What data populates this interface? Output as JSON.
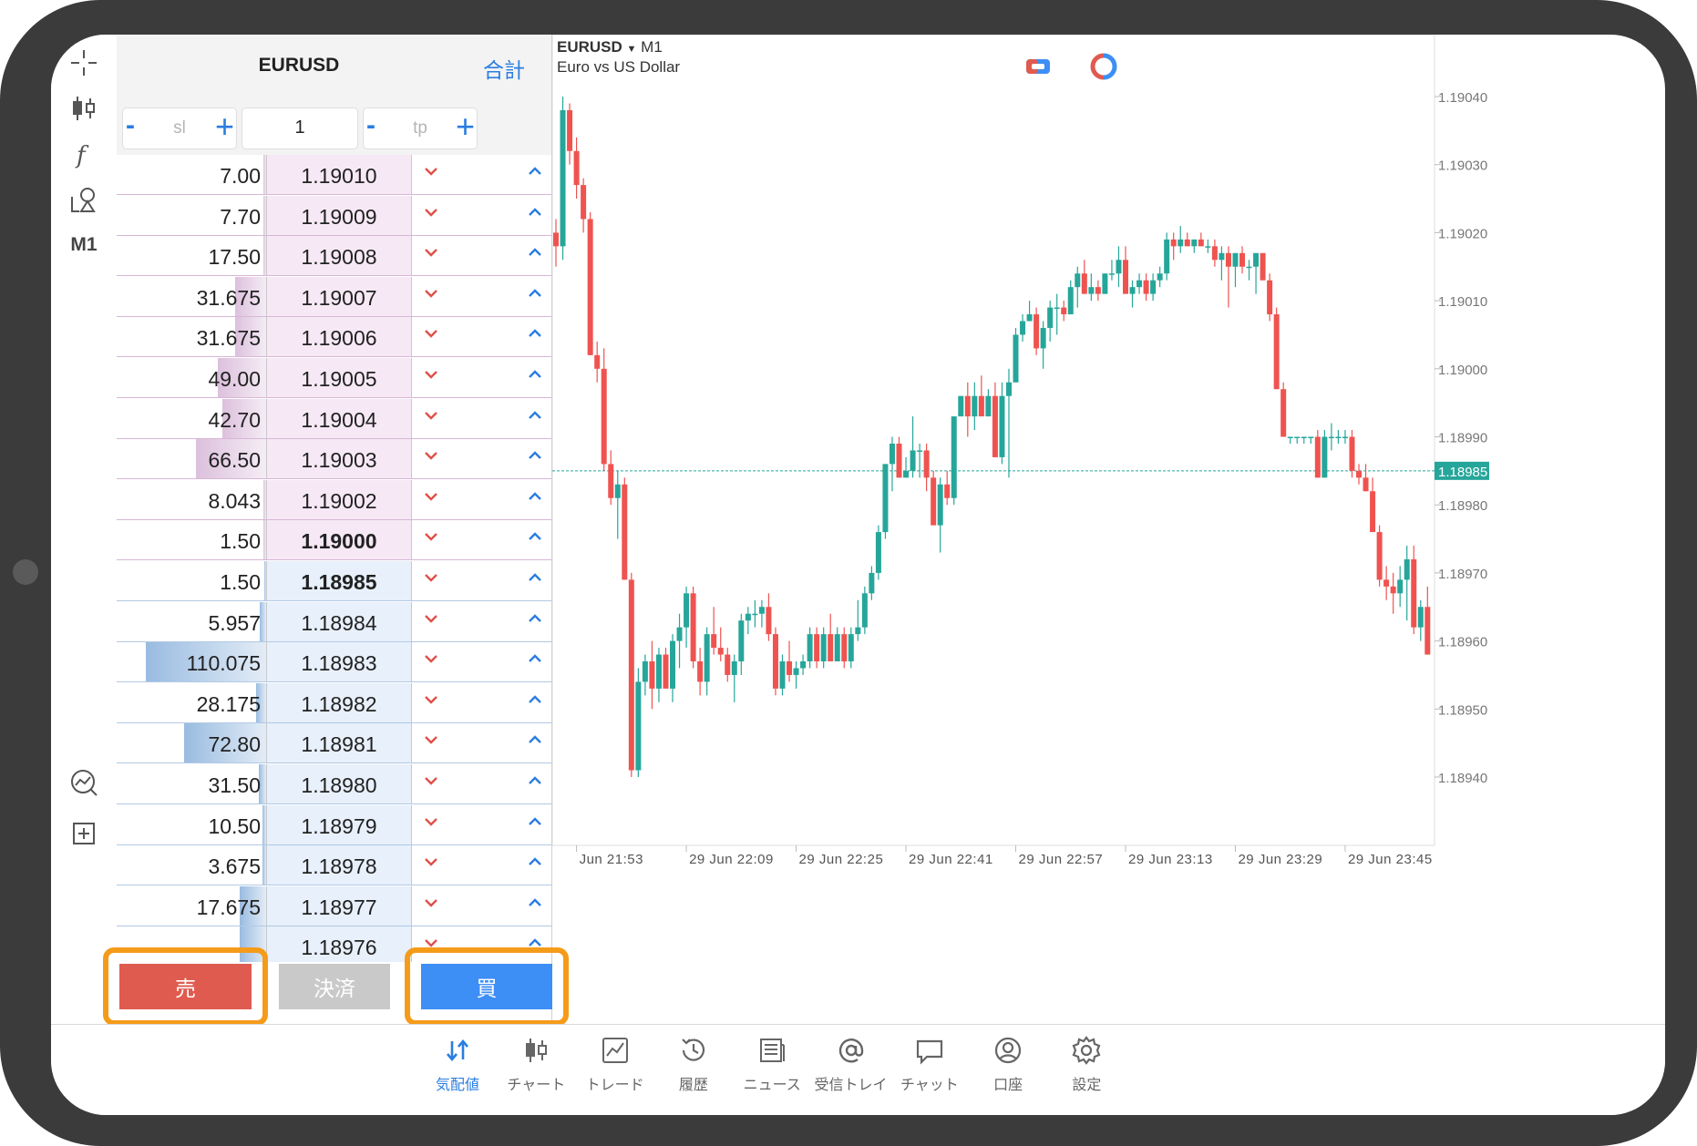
{
  "dom": {
    "symbol": "EURUSD",
    "total_label": "合計",
    "sl": {
      "placeholder": "sl"
    },
    "volume": "1",
    "tp": {
      "placeholder": "tp"
    },
    "sell_rows": [
      {
        "volume": "7.00",
        "price": "1.19010",
        "bar": 0.02
      },
      {
        "volume": "7.70",
        "price": "1.19009",
        "bar": 0.02
      },
      {
        "volume": "17.50",
        "price": "1.19008",
        "bar": 0.02
      },
      {
        "volume": "31.675",
        "price": "1.19007",
        "bar": 0.26
      },
      {
        "volume": "31.675",
        "price": "1.19006",
        "bar": 0.26
      },
      {
        "volume": "49.00",
        "price": "1.19005",
        "bar": 0.4
      },
      {
        "volume": "42.70",
        "price": "1.19004",
        "bar": 0.36
      },
      {
        "volume": "66.50",
        "price": "1.19003",
        "bar": 0.58
      },
      {
        "volume": "8.043",
        "price": "1.19002",
        "bar": 0.02
      },
      {
        "volume": "1.50",
        "price": "1.19000",
        "bar": 0.02,
        "bold": true
      }
    ],
    "buy_rows": [
      {
        "volume": "1.50",
        "price": "1.18985",
        "bar": 0.01,
        "bold": true
      },
      {
        "volume": "5.957",
        "price": "1.18984",
        "bar": 0.05
      },
      {
        "volume": "110.075",
        "price": "1.18983",
        "bar": 1.0
      },
      {
        "volume": "28.175",
        "price": "1.18982",
        "bar": 0.08
      },
      {
        "volume": "72.80",
        "price": "1.18981",
        "bar": 0.68
      },
      {
        "volume": "31.50",
        "price": "1.18980",
        "bar": 0.06
      },
      {
        "volume": "10.50",
        "price": "1.18979",
        "bar": 0.03
      },
      {
        "volume": "3.675",
        "price": "1.18978",
        "bar": 0.03
      },
      {
        "volume": "17.675",
        "price": "1.18977",
        "bar": 0.22
      },
      {
        "volume": "",
        "price": "1.18976",
        "bar": 0.22
      }
    ]
  },
  "buttons": {
    "sell": "売",
    "close": "決済",
    "buy": "買"
  },
  "toolbar": {
    "timeframe": "M1"
  },
  "chart": {
    "symbol": "EURUSD",
    "timeframe": "M1",
    "description": "Euro vs US Dollar",
    "current_price": "1.18985",
    "colors": {
      "bull": "#26a69a",
      "bear": "#ef5350",
      "price_line": "#26a69a",
      "highlight": "#f59b1a"
    }
  },
  "chart_data": {
    "type": "candlestick",
    "ylim": [
      1.18935,
      1.19045
    ],
    "yticks": [
      "1.19040",
      "1.19030",
      "1.19020",
      "1.19010",
      "1.19000",
      "1.18990",
      "1.18980",
      "1.18970",
      "1.18960",
      "1.18950",
      "1.18940"
    ],
    "xticks": [
      "Jun 21:53",
      "29 Jun 22:09",
      "29 Jun 22:25",
      "29 Jun 22:41",
      "29 Jun 22:57",
      "29 Jun 23:13",
      "29 Jun 23:29",
      "29 Jun 23:45"
    ],
    "xtick_index": [
      3,
      19,
      35,
      51,
      67,
      83,
      99,
      115
    ],
    "current_price": 1.18985,
    "candles": [
      [
        1.1902,
        1.19022,
        1.19015,
        1.19018
      ],
      [
        1.19018,
        1.1904,
        1.19016,
        1.19038
      ],
      [
        1.19038,
        1.19039,
        1.1903,
        1.19032
      ],
      [
        1.19032,
        1.19034,
        1.19025,
        1.19027
      ],
      [
        1.19027,
        1.19028,
        1.1902,
        1.19022
      ],
      [
        1.19022,
        1.19023,
        1.19002,
        1.19002
      ],
      [
        1.19002,
        1.19004,
        1.18998,
        1.19
      ],
      [
        1.19,
        1.19003,
        1.18985,
        1.18986
      ],
      [
        1.18986,
        1.18988,
        1.1898,
        1.18981
      ],
      [
        1.18981,
        1.18985,
        1.18975,
        1.18983
      ],
      [
        1.18983,
        1.18984,
        1.18969,
        1.18969
      ],
      [
        1.18969,
        1.1897,
        1.1894,
        1.18941
      ],
      [
        1.18941,
        1.18956,
        1.1894,
        1.18954
      ],
      [
        1.18954,
        1.18958,
        1.18952,
        1.18957
      ],
      [
        1.18957,
        1.1896,
        1.1895,
        1.18953
      ],
      [
        1.18953,
        1.18959,
        1.18951,
        1.18958
      ],
      [
        1.18958,
        1.18959,
        1.18953,
        1.18953
      ],
      [
        1.18953,
        1.18961,
        1.18951,
        1.1896
      ],
      [
        1.1896,
        1.18964,
        1.18956,
        1.18962
      ],
      [
        1.18962,
        1.18968,
        1.18959,
        1.18967
      ],
      [
        1.18967,
        1.18968,
        1.18956,
        1.18957
      ],
      [
        1.18957,
        1.18959,
        1.18952,
        1.18954
      ],
      [
        1.18954,
        1.18962,
        1.18952,
        1.18961
      ],
      [
        1.18961,
        1.18965,
        1.18958,
        1.18959
      ],
      [
        1.18959,
        1.18962,
        1.18957,
        1.18958
      ],
      [
        1.18958,
        1.18959,
        1.18954,
        1.18955
      ],
      [
        1.18955,
        1.18958,
        1.18951,
        1.18957
      ],
      [
        1.18957,
        1.18964,
        1.18955,
        1.18963
      ],
      [
        1.18963,
        1.18965,
        1.18961,
        1.18964
      ],
      [
        1.18964,
        1.18966,
        1.18962,
        1.18964
      ],
      [
        1.18964,
        1.18966,
        1.18962,
        1.18965
      ],
      [
        1.18965,
        1.18967,
        1.1896,
        1.18961
      ],
      [
        1.18961,
        1.18962,
        1.18952,
        1.18953
      ],
      [
        1.18953,
        1.18958,
        1.18952,
        1.18957
      ],
      [
        1.18957,
        1.1896,
        1.18954,
        1.18955
      ],
      [
        1.18955,
        1.18957,
        1.18953,
        1.18956
      ],
      [
        1.18956,
        1.18958,
        1.18955,
        1.18957
      ],
      [
        1.18957,
        1.18962,
        1.18956,
        1.18961
      ],
      [
        1.18961,
        1.18962,
        1.18956,
        1.18957
      ],
      [
        1.18957,
        1.18962,
        1.18956,
        1.18961
      ],
      [
        1.18961,
        1.18964,
        1.18957,
        1.18957
      ],
      [
        1.18957,
        1.18962,
        1.18957,
        1.18961
      ],
      [
        1.18961,
        1.18962,
        1.18956,
        1.18957
      ],
      [
        1.18957,
        1.18962,
        1.18956,
        1.18961
      ],
      [
        1.18961,
        1.18966,
        1.1896,
        1.18962
      ],
      [
        1.18962,
        1.18968,
        1.18961,
        1.18967
      ],
      [
        1.18967,
        1.18971,
        1.18966,
        1.1897
      ],
      [
        1.1897,
        1.18977,
        1.18969,
        1.18976
      ],
      [
        1.18976,
        1.18986,
        1.18975,
        1.18986
      ],
      [
        1.18986,
        1.1899,
        1.18982,
        1.18989
      ],
      [
        1.18989,
        1.1899,
        1.18984,
        1.18984
      ],
      [
        1.18984,
        1.18987,
        1.18984,
        1.18985
      ],
      [
        1.18985,
        1.18993,
        1.18984,
        1.18988
      ],
      [
        1.18988,
        1.18989,
        1.18984,
        1.18988
      ],
      [
        1.18988,
        1.18989,
        1.18982,
        1.18984
      ],
      [
        1.18984,
        1.18985,
        1.18977,
        1.18977
      ],
      [
        1.18977,
        1.18984,
        1.18973,
        1.18983
      ],
      [
        1.18983,
        1.18985,
        1.1898,
        1.18981
      ],
      [
        1.18981,
        1.18993,
        1.1898,
        1.18993
      ],
      [
        1.18993,
        1.18996,
        1.18993,
        1.18996
      ],
      [
        1.18996,
        1.18998,
        1.1899,
        1.18993
      ],
      [
        1.18993,
        1.18998,
        1.18991,
        1.18996
      ],
      [
        1.18996,
        1.18999,
        1.18993,
        1.18993
      ],
      [
        1.18993,
        1.18997,
        1.18993,
        1.18996
      ],
      [
        1.18996,
        1.18998,
        1.18987,
        1.18987
      ],
      [
        1.18987,
        1.18998,
        1.18986,
        1.18996
      ],
      [
        1.18996,
        1.19,
        1.18984,
        1.18998
      ],
      [
        1.18998,
        1.19006,
        1.18998,
        1.19005
      ],
      [
        1.19005,
        1.19008,
        1.19004,
        1.19007
      ],
      [
        1.19007,
        1.1901,
        1.19007,
        1.19008
      ],
      [
        1.19008,
        1.19009,
        1.19002,
        1.19003
      ],
      [
        1.19003,
        1.19007,
        1.19,
        1.19006
      ],
      [
        1.19006,
        1.1901,
        1.19004,
        1.19009
      ],
      [
        1.19009,
        1.19011,
        1.19005,
        1.19009
      ],
      [
        1.19009,
        1.1901,
        1.19007,
        1.19008
      ],
      [
        1.19008,
        1.19013,
        1.19008,
        1.19012
      ],
      [
        1.19012,
        1.19015,
        1.19009,
        1.19014
      ],
      [
        1.19014,
        1.19016,
        1.19011,
        1.19011
      ],
      [
        1.19011,
        1.19014,
        1.1901,
        1.19012
      ],
      [
        1.19012,
        1.19013,
        1.1901,
        1.19011
      ],
      [
        1.19011,
        1.19014,
        1.19011,
        1.19014
      ],
      [
        1.19014,
        1.19016,
        1.19013,
        1.19014
      ],
      [
        1.19014,
        1.19018,
        1.19012,
        1.19016
      ],
      [
        1.19016,
        1.19018,
        1.19011,
        1.19011
      ],
      [
        1.19011,
        1.19013,
        1.19009,
        1.19012
      ],
      [
        1.19012,
        1.19014,
        1.19011,
        1.19013
      ],
      [
        1.19013,
        1.19014,
        1.1901,
        1.19011
      ],
      [
        1.19011,
        1.19014,
        1.1901,
        1.19013
      ],
      [
        1.19013,
        1.19015,
        1.19012,
        1.19014
      ],
      [
        1.19014,
        1.1902,
        1.19013,
        1.19019
      ],
      [
        1.19019,
        1.1902,
        1.19016,
        1.19018
      ],
      [
        1.19018,
        1.19021,
        1.19017,
        1.19019
      ],
      [
        1.19019,
        1.1902,
        1.19018,
        1.19018
      ],
      [
        1.19018,
        1.19019,
        1.19017,
        1.19019
      ],
      [
        1.19019,
        1.1902,
        1.19018,
        1.19018
      ],
      [
        1.19018,
        1.19019,
        1.19017,
        1.19018
      ],
      [
        1.19018,
        1.19019,
        1.19015,
        1.19016
      ],
      [
        1.19016,
        1.19018,
        1.19013,
        1.19017
      ],
      [
        1.19017,
        1.19018,
        1.19009,
        1.19015
      ],
      [
        1.19015,
        1.19017,
        1.19012,
        1.19017
      ],
      [
        1.19017,
        1.19018,
        1.19014,
        1.19015
      ],
      [
        1.19015,
        1.19016,
        1.19013,
        1.19015
      ],
      [
        1.19015,
        1.19017,
        1.19011,
        1.19017
      ],
      [
        1.19017,
        1.19017,
        1.19013,
        1.19013
      ],
      [
        1.19013,
        1.19014,
        1.19007,
        1.19008
      ],
      [
        1.19008,
        1.19009,
        1.18997,
        1.18997
      ],
      [
        1.18997,
        1.18998,
        1.1899,
        1.1899
      ],
      [
        1.1899,
        1.1899,
        1.18989,
        1.1899
      ],
      [
        1.1899,
        1.1899,
        1.18989,
        1.1899
      ],
      [
        1.1899,
        1.1899,
        1.18989,
        1.1899
      ],
      [
        1.1899,
        1.1899,
        1.18989,
        1.1899
      ],
      [
        1.1899,
        1.18991,
        1.18984,
        1.18984
      ],
      [
        1.18984,
        1.18991,
        1.18984,
        1.1899
      ],
      [
        1.1899,
        1.18992,
        1.18988,
        1.1899
      ],
      [
        1.1899,
        1.18991,
        1.18989,
        1.1899
      ],
      [
        1.1899,
        1.18991,
        1.18989,
        1.1899
      ],
      [
        1.1899,
        1.18991,
        1.18984,
        1.18985
      ],
      [
        1.18985,
        1.18986,
        1.18983,
        1.18984
      ],
      [
        1.18984,
        1.18986,
        1.18982,
        1.18982
      ],
      [
        1.18982,
        1.18984,
        1.18976,
        1.18976
      ],
      [
        1.18976,
        1.18977,
        1.18968,
        1.18969
      ],
      [
        1.18969,
        1.18971,
        1.18966,
        1.18968
      ],
      [
        1.18968,
        1.1897,
        1.18964,
        1.18967
      ],
      [
        1.18967,
        1.18971,
        1.18965,
        1.18969
      ],
      [
        1.18969,
        1.18974,
        1.18963,
        1.18972
      ],
      [
        1.18972,
        1.18974,
        1.18961,
        1.18962
      ],
      [
        1.18962,
        1.18966,
        1.1896,
        1.18965
      ],
      [
        1.18965,
        1.18968,
        1.18958,
        1.18958
      ],
      [
        1.18958,
        1.18961,
        1.18952,
        1.18955
      ],
      [
        1.18955,
        1.1896,
        1.18949,
        1.18957
      ],
      [
        1.18957,
        1.18962,
        1.18956,
        1.18957
      ],
      [
        1.18957,
        1.18962,
        1.18953,
        1.18961
      ]
    ]
  },
  "nav": {
    "items": [
      {
        "label": "気配値",
        "icon": "quotes-icon",
        "active": true
      },
      {
        "label": "チャート",
        "icon": "chart-icon"
      },
      {
        "label": "トレード",
        "icon": "trade-icon"
      },
      {
        "label": "履歴",
        "icon": "history-icon"
      },
      {
        "label": "ニュース",
        "icon": "news-icon"
      },
      {
        "label": "受信トレイ",
        "icon": "mailbox-icon"
      },
      {
        "label": "チャット",
        "icon": "chat-icon"
      },
      {
        "label": "口座",
        "icon": "account-icon"
      },
      {
        "label": "設定",
        "icon": "settings-icon"
      }
    ]
  }
}
